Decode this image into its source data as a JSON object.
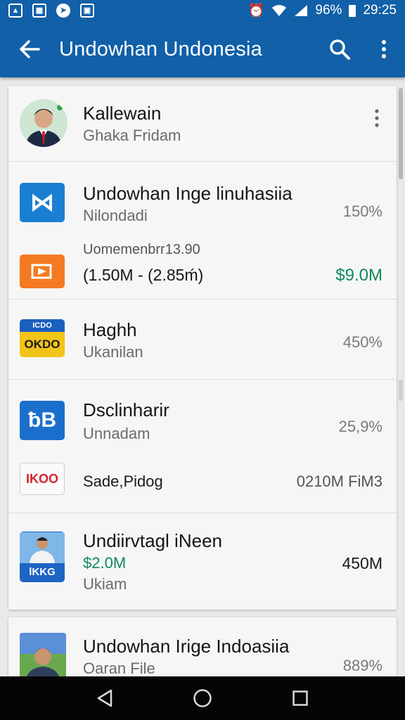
{
  "status_bar": {
    "battery": "96%",
    "time": "29:25"
  },
  "app_bar": {
    "title": "Undowhan Undonesia"
  },
  "profile": {
    "name": "Kallewain",
    "subtitle": "Ghaka Fridam"
  },
  "items": [
    {
      "logo_text": "⋈",
      "title": "Undowhan Inge linuhasiia",
      "subtitle": "Nilondadi",
      "right_value": "150%",
      "sub_row": {
        "label": "Uomemenbrr13.90",
        "range": "(1.50M - (2.85ḿ)",
        "right_value": "$9.0M"
      }
    },
    {
      "logo_text": "OKDO",
      "logo_top_text": "ICDO",
      "title": "Haghh",
      "subtitle": "Ukanilan",
      "right_value": "450%"
    },
    {
      "logo_text": "ƀB",
      "title": "Dsclinharir",
      "subtitle": "Unnadam",
      "right_value": "25,9%",
      "sub_row": {
        "logo_text": "IKOO",
        "label": "Sade,Pidog",
        "right_value": "0210M FiM3"
      }
    },
    {
      "logo_text": "lKKG",
      "title": "Undiirvtagl iNeen",
      "price": "$2.0M",
      "subtitle": "Ukiam",
      "right_value": "450M"
    },
    {
      "title": "Undowhan Irige Indoasiia",
      "subtitle": "Oaran File",
      "right_value": "889%"
    }
  ],
  "colors": {
    "primary": "#1160a8",
    "accent_green": "#0e8a5b",
    "navbar": "#050505"
  },
  "icons": {
    "back": "arrow-left-icon",
    "search": "search-icon",
    "overflow": "more-vert-icon"
  }
}
